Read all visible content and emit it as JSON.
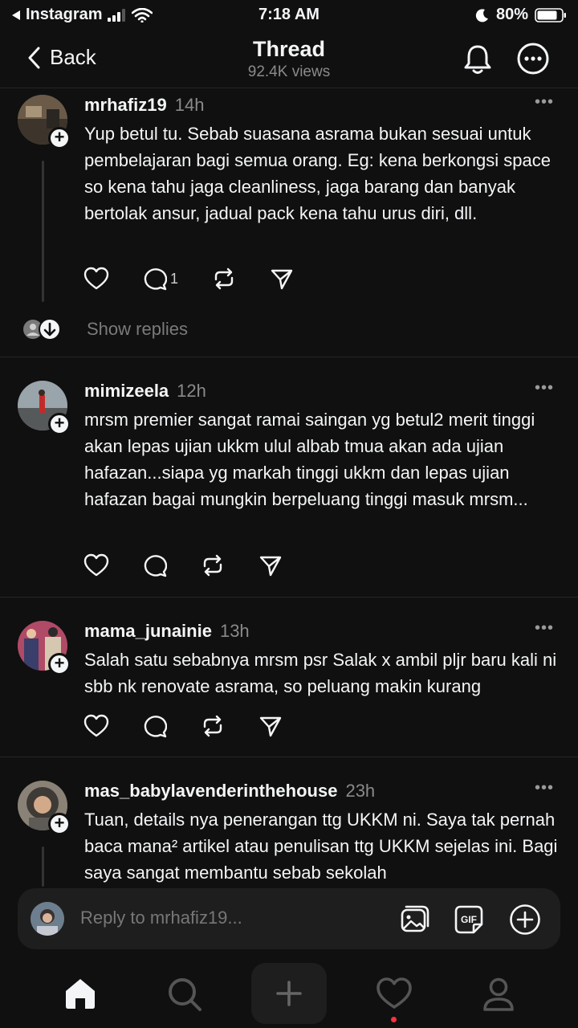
{
  "status_bar": {
    "back_app": "Instagram",
    "time": "7:18 AM",
    "battery": "80%"
  },
  "header": {
    "back_label": "Back",
    "title": "Thread",
    "views": "92.4K views"
  },
  "posts": [
    {
      "username": "mrhafiz19",
      "time": "14h",
      "text": "Yup betul tu. Sebab suasana asrama bukan sesuai untuk pembelajaran bagi semua orang. Eg: kena berkongsi space so kena tahu jaga cleanliness, jaga barang dan banyak bertolak ansur, jadual pack kena tahu urus diri, dll.",
      "reply_count": "1"
    },
    {
      "username": "mimizeela",
      "time": "12h",
      "text": "mrsm premier sangat ramai saingan yg betul2 merit tinggi akan lepas ujian ukkm ulul albab tmua akan ada ujian hafazan...siapa yg markah tinggi ukkm dan lepas ujian hafazan bagai mungkin berpeluang tinggi masuk mrsm...",
      "reply_count": ""
    },
    {
      "username": "mama_junainie",
      "time": "13h",
      "text": "Salah satu sebabnya mrsm psr Salak x ambil pljr baru kali ni sbb nk renovate asrama, so peluang makin kurang",
      "reply_count": ""
    },
    {
      "username": "mas_babylavenderinthehouse",
      "time": "23h",
      "text": "Tuan, details nya penerangan ttg UKKM ni. Saya tak pernah baca mana² artikel atau penulisan ttg UKKM sejelas ini. Bagi saya sangat membantu sebab sekolah",
      "reply_count": ""
    }
  ],
  "show_replies_label": "Show replies",
  "reply_bar": {
    "placeholder": "Reply to mrhafiz19...",
    "gif_label": "GIF"
  },
  "icons": {
    "back": "chevron-left-icon",
    "bell": "bell-icon",
    "more": "more-circle-icon",
    "like": "heart-icon",
    "comment": "comment-icon",
    "repost": "repost-icon",
    "share": "send-icon"
  },
  "colors": {
    "background": "#101010",
    "text": "#f3f5f7",
    "muted": "#8a8a8a",
    "notification_dot": "#ff3040"
  }
}
